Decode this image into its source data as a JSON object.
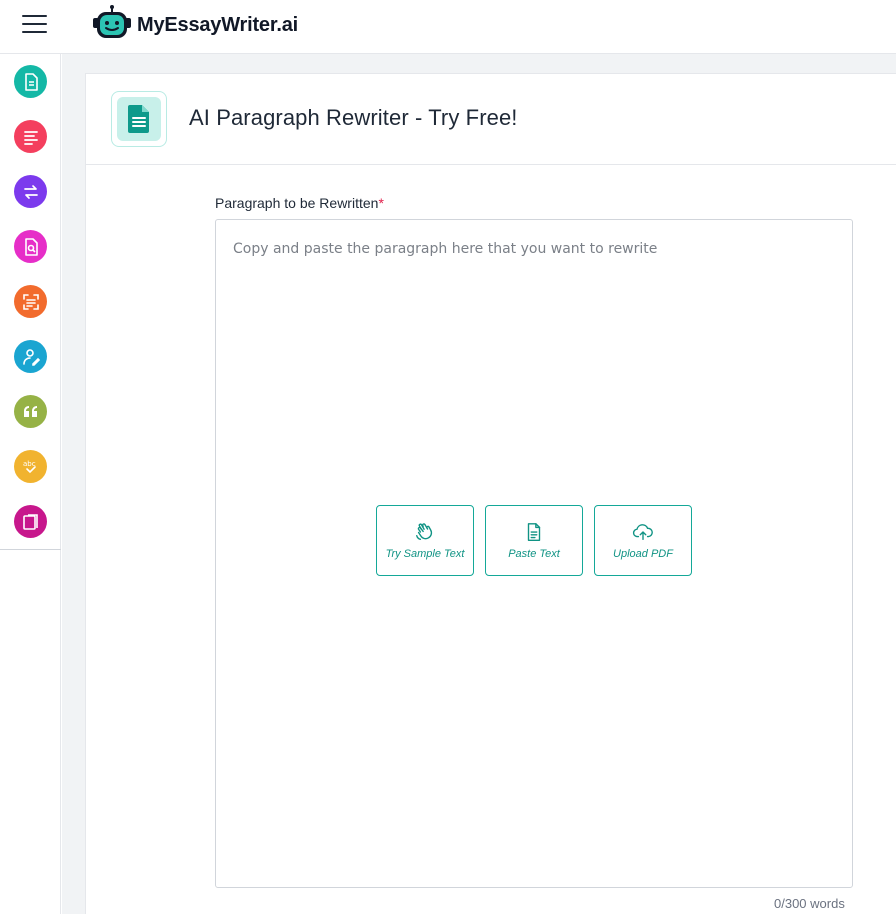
{
  "header": {
    "brand": "MyEssayWriter.ai",
    "menu_icon": "hamburger-menu-icon",
    "logo_icon": "robot-logo-icon"
  },
  "sidebar": {
    "items": [
      {
        "icon": "document-icon",
        "color": "#14b8a6"
      },
      {
        "icon": "text-lines-icon",
        "color": "#f43f5e"
      },
      {
        "icon": "rewrite-arrows-icon",
        "color": "#7c3aed"
      },
      {
        "icon": "document-search-icon",
        "color": "#e62ec8"
      },
      {
        "icon": "scan-text-icon",
        "color": "#f26b2d"
      },
      {
        "icon": "user-edit-icon",
        "color": "#1aa5d1"
      },
      {
        "icon": "quote-icon",
        "color": "#96b246"
      },
      {
        "icon": "abc-spellcheck-icon",
        "color": "#f1b32f"
      },
      {
        "icon": "pages-icon",
        "color": "#c7178c"
      }
    ]
  },
  "tool": {
    "icon": "document-text-icon",
    "title": "AI Paragraph Rewriter - Try Free!"
  },
  "form": {
    "label": "Paragraph to be Rewritten",
    "required_mark": "*",
    "placeholder": "Copy and paste the paragraph here that you want to rewrite",
    "actions": [
      {
        "label": "Try Sample Text",
        "icon": "hand-wave-icon"
      },
      {
        "label": "Paste Text",
        "icon": "paste-document-icon"
      },
      {
        "label": "Upload PDF",
        "icon": "cloud-upload-icon"
      }
    ],
    "word_count": "0/300 words"
  },
  "colors": {
    "accent": "#14a898",
    "required": "#e11d48"
  }
}
